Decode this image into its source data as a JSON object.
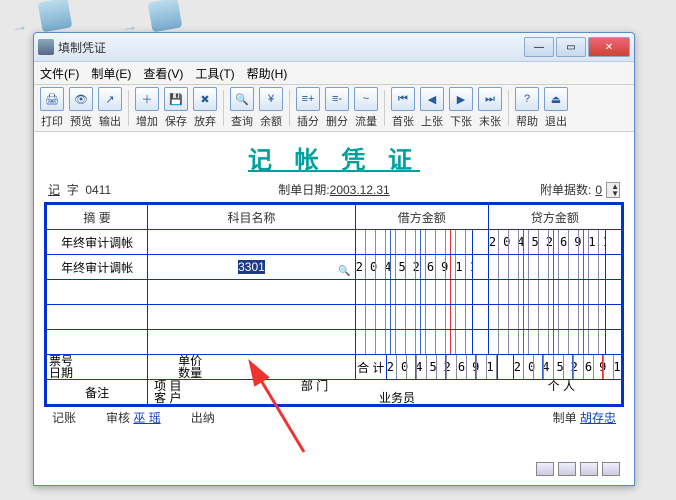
{
  "window": {
    "title": "填制凭证"
  },
  "menus": {
    "file": "文件(F)",
    "make": "制单(E)",
    "view": "查看(V)",
    "tool": "工具(T)",
    "help": "帮助(H)"
  },
  "toolbar": {
    "print": "打印",
    "preview": "预览",
    "output": "输出",
    "add": "增加",
    "save": "保存",
    "abandon": "放弃",
    "query": "查询",
    "balance": "余额",
    "insrow": "插分",
    "delrow": "删分",
    "flow": "流量",
    "first": "首张",
    "prev": "上张",
    "next": "下张",
    "last": "末张",
    "helpb": "帮助",
    "exit": "退出"
  },
  "voucher": {
    "title": "记 帐 凭 证",
    "type_label": "记",
    "word_label": "字",
    "number": "0411",
    "date_label": "制单日期:",
    "date": "2003.12.31",
    "attach_label": "附单据数:",
    "attach": "0"
  },
  "cols": {
    "summary": "摘 要",
    "subject": "科目名称",
    "debit": "借方金额",
    "credit": "贷方金额"
  },
  "rows": [
    {
      "summary": "年终审计调帐",
      "subject": "",
      "debit": "",
      "credit": "204526911"
    },
    {
      "summary": "年终审计调帐",
      "subject": "3301",
      "debit": "204526911",
      "credit": ""
    },
    {
      "summary": "",
      "subject": "",
      "debit": "",
      "credit": ""
    },
    {
      "summary": "",
      "subject": "",
      "debit": "",
      "credit": ""
    },
    {
      "summary": "",
      "subject": "",
      "debit": "",
      "credit": ""
    }
  ],
  "footer_labels": {
    "ticket": "票号",
    "date": "日期",
    "price": "单价",
    "qty": "数量",
    "total": "合 计"
  },
  "totals": {
    "debit": "204526911",
    "credit": "204526911"
  },
  "remark": {
    "label": "备注",
    "project": "项 目",
    "customer": "客 户",
    "dept": "部 门",
    "person": "个 人",
    "biz": "业务员"
  },
  "bottom": {
    "book": "记账",
    "audit": "审核",
    "auditor": "巫 瑶",
    "cashier": "出纳",
    "maker": "制单",
    "maker_name": "胡存忠"
  }
}
